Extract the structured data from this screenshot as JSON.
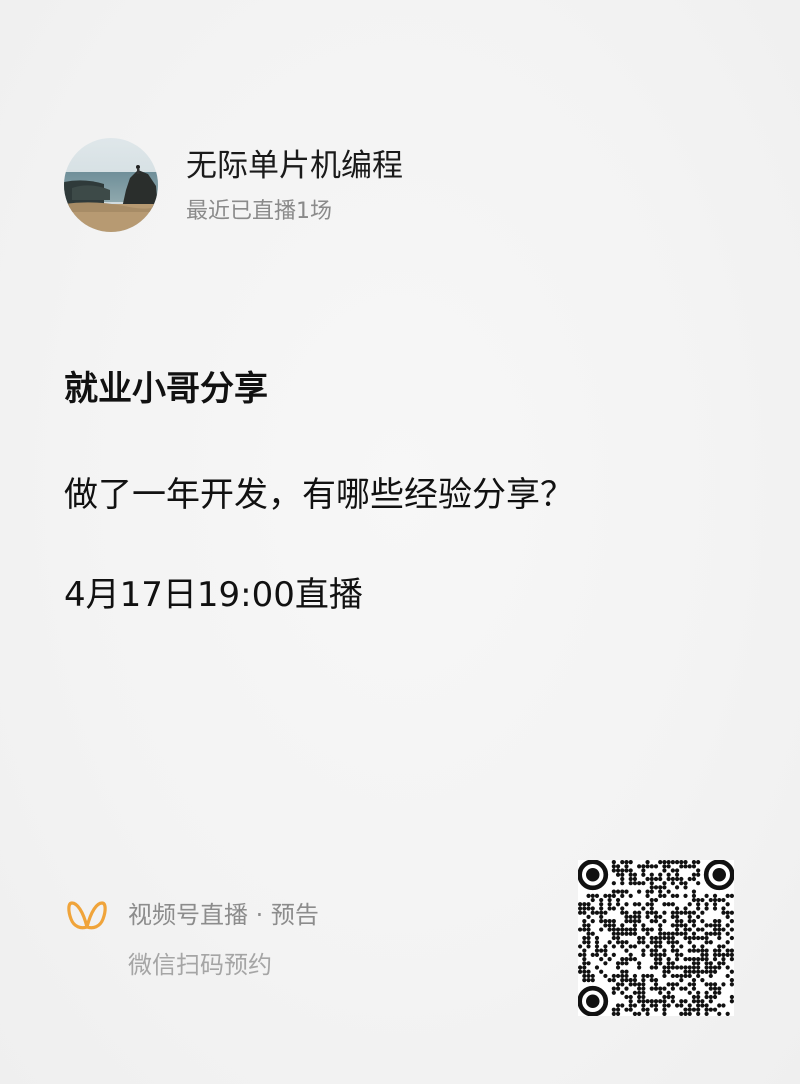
{
  "account": {
    "name": "无际单片机编程",
    "subtitle": "最近已直播1场"
  },
  "live": {
    "title": "就业小哥分享",
    "description": "做了一年开发，有哪些经验分享？",
    "schedule": "4月17日19:00直播"
  },
  "footer": {
    "brand": "视频号直播 · 预告",
    "action": "微信扫码预约",
    "logo_icon": "channels-butterfly-icon",
    "accent_color": "#f0a43a"
  },
  "qr_code": {
    "icon": "qr-code-icon"
  }
}
